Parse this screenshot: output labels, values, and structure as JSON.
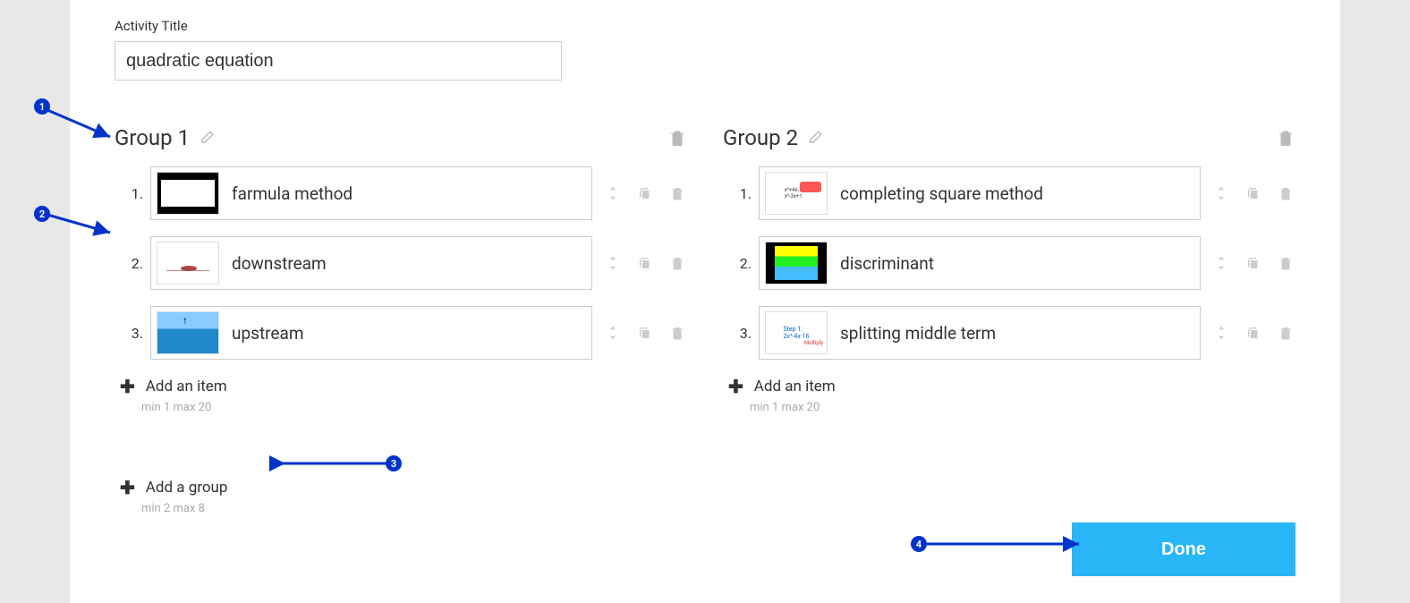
{
  "title_label": "Activity Title",
  "title_value": "quadratic equation",
  "groups": [
    {
      "name": "Group 1",
      "items": [
        {
          "num": "1.",
          "label": "farmula method"
        },
        {
          "num": "2.",
          "label": "downstream"
        },
        {
          "num": "3.",
          "label": "upstream"
        }
      ],
      "add_item_label": "Add an item",
      "minmax": "min 1   max 20"
    },
    {
      "name": "Group 2",
      "items": [
        {
          "num": "1.",
          "label": "completing square method"
        },
        {
          "num": "2.",
          "label": "discriminant"
        },
        {
          "num": "3.",
          "label": "splitting middle term"
        }
      ],
      "add_item_label": "Add an item",
      "minmax": "min 1   max 20"
    }
  ],
  "add_group_label": "Add a group",
  "add_group_minmax": "min 2   max 8",
  "done_label": "Done",
  "callouts": {
    "c1": "1",
    "c2": "2",
    "c3": "3",
    "c4": "4"
  }
}
